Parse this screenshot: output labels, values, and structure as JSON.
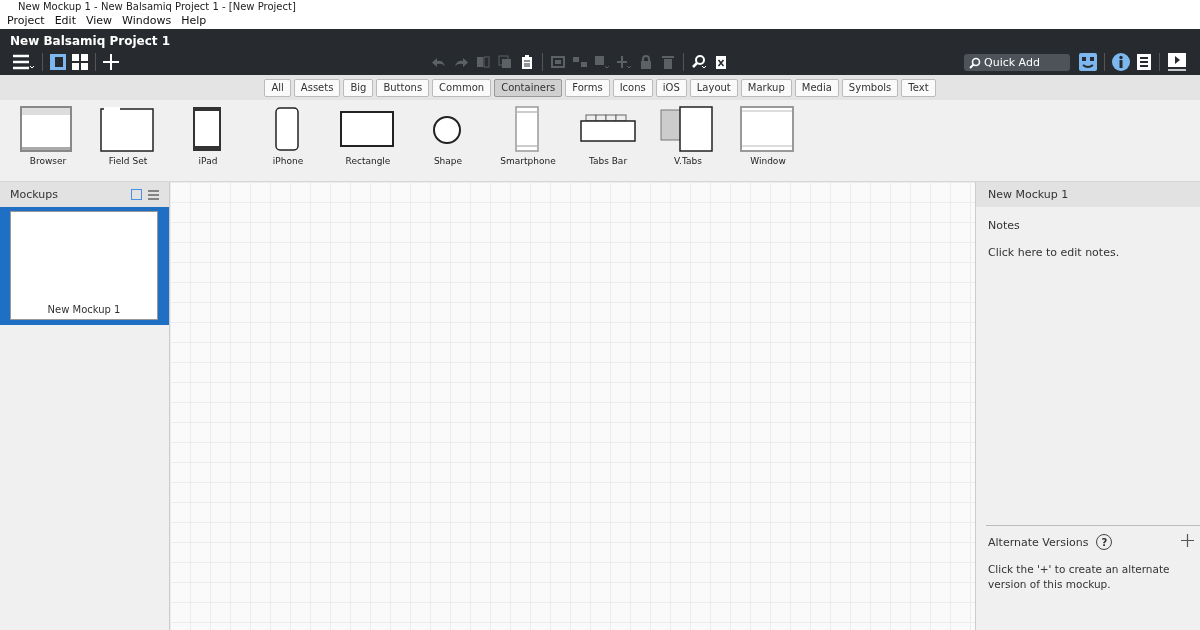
{
  "window": {
    "title": "New Mockup 1 - New Balsamiq Project 1 - [New Project]"
  },
  "menu": [
    "Project",
    "Edit",
    "View",
    "Windows",
    "Help"
  ],
  "project_title": "New Balsamiq Project 1",
  "toolbar": {
    "left": [
      {
        "kind": "menu",
        "selected": false
      },
      {
        "kind": "single-view",
        "selected": true
      },
      {
        "kind": "grid-view",
        "selected": false
      },
      {
        "kind": "add",
        "selected": false
      }
    ],
    "center": [
      {
        "kind": "undo",
        "disabled": true
      },
      {
        "kind": "redo",
        "disabled": true
      },
      {
        "kind": "copy",
        "disabled": true
      },
      {
        "kind": "duplicate",
        "disabled": true
      },
      {
        "kind": "paste",
        "disabled": false
      },
      {
        "kind": "group",
        "disabled": true
      },
      {
        "kind": "ungroup",
        "disabled": true
      },
      {
        "kind": "arrange",
        "disabled": true
      },
      {
        "kind": "align",
        "disabled": true
      },
      {
        "kind": "lock",
        "disabled": true
      },
      {
        "kind": "delete",
        "disabled": true
      },
      {
        "kind": "find",
        "disabled": false
      },
      {
        "kind": "clipboard-clear",
        "disabled": false
      }
    ],
    "search": {
      "placeholder": "Quick Add"
    },
    "right": [
      {
        "kind": "face"
      },
      {
        "kind": "info"
      },
      {
        "kind": "list"
      },
      {
        "kind": "present"
      }
    ]
  },
  "filters": [
    {
      "label": "All",
      "selected": false
    },
    {
      "label": "Assets",
      "selected": false
    },
    {
      "label": "Big",
      "selected": false
    },
    {
      "label": "Buttons",
      "selected": false
    },
    {
      "label": "Common",
      "selected": false
    },
    {
      "label": "Containers",
      "selected": true
    },
    {
      "label": "Forms",
      "selected": false
    },
    {
      "label": "Icons",
      "selected": false
    },
    {
      "label": "iOS",
      "selected": false
    },
    {
      "label": "Layout",
      "selected": false
    },
    {
      "label": "Markup",
      "selected": false
    },
    {
      "label": "Media",
      "selected": false
    },
    {
      "label": "Symbols",
      "selected": false
    },
    {
      "label": "Text",
      "selected": false
    }
  ],
  "components": [
    {
      "kind": "browser",
      "label": "Browser"
    },
    {
      "kind": "fieldset",
      "label": "Field Set"
    },
    {
      "kind": "ipad",
      "label": "iPad"
    },
    {
      "kind": "iphone",
      "label": "iPhone"
    },
    {
      "kind": "rectangle",
      "label": "Rectangle"
    },
    {
      "kind": "shape",
      "label": "Shape"
    },
    {
      "kind": "smartphone",
      "label": "Smartphone"
    },
    {
      "kind": "tabsbar",
      "label": "Tabs Bar"
    },
    {
      "kind": "vtabs",
      "label": "V.Tabs"
    },
    {
      "kind": "window",
      "label": "Window"
    }
  ],
  "mockups_panel": {
    "title": "Mockups",
    "items": [
      {
        "label": "New Mockup 1",
        "selected": true
      }
    ]
  },
  "inspector": {
    "title": "New Mockup 1",
    "notes_label": "Notes",
    "notes_hint": "Click here to edit notes.",
    "alternate_label": "Alternate Versions",
    "help": "?",
    "alternate_hint": "Click the '+' to create an alternate version of this mockup."
  }
}
